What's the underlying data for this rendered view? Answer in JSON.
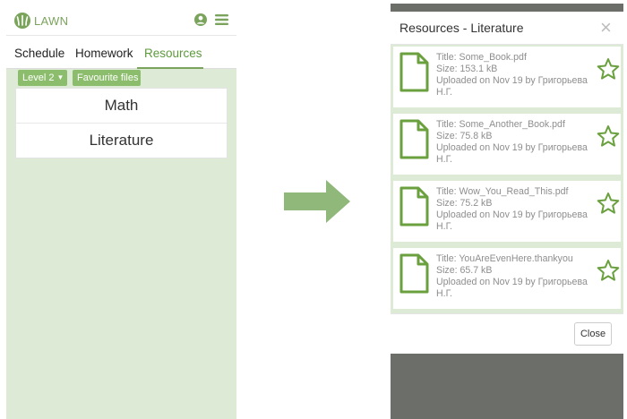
{
  "left": {
    "app_name": "LAWN",
    "tabs": [
      {
        "label": "Schedule"
      },
      {
        "label": "Homework"
      },
      {
        "label": "Resources"
      }
    ],
    "level_button": "Level 2",
    "favourites_button": "Favourite files",
    "subjects": [
      {
        "label": "Math"
      },
      {
        "label": "Literature"
      }
    ],
    "colors": {
      "brand": "#7aa35c",
      "background": "#ddead5",
      "button": "#8bbd6c"
    }
  },
  "modal": {
    "title": "Resources - Literature",
    "close_symbol": "×",
    "close_button": "Close",
    "files": [
      {
        "title": "Title: Some_Book.pdf",
        "size": "Size: 153.1 kB",
        "uploaded": "Uploaded on Nov 19 by Григорьева",
        "uploader_suffix": "Н.Г."
      },
      {
        "title": "Title: Some_Another_Book.pdf",
        "size": "Size: 75.8 kB",
        "uploaded": "Uploaded on Nov 19 by Григорьева",
        "uploader_suffix": "Н.Г."
      },
      {
        "title": "Title: Wow_You_Read_This.pdf",
        "size": "Size: 75.2 kB",
        "uploaded": "Uploaded on Nov 19 by Григорьева",
        "uploader_suffix": "Н.Г."
      },
      {
        "title": "Title: YouAreEvenHere.thankyou",
        "size": "Size: 65.7 kB",
        "uploaded": "Uploaded on Nov 19 by Григорьева",
        "uploader_suffix": "Н.Г."
      }
    ],
    "icons": {
      "file": "file-icon",
      "favourite": "star-outline-icon"
    },
    "colors": {
      "accent": "#6aa03e",
      "overlay": "#6b6e69"
    }
  }
}
